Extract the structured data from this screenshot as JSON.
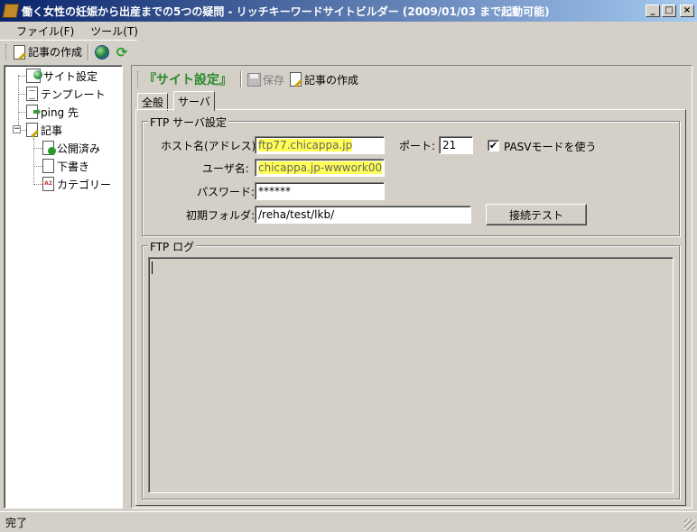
{
  "window": {
    "title": "働く女性の妊娠から出産までの5つの疑問 - リッチキーワードサイトビルダー (2009/01/03 まで起動可能)",
    "minimize": "_",
    "maximize": "□",
    "close": "×"
  },
  "menu": {
    "items": [
      "ファイル(F)",
      "ツール(T)"
    ]
  },
  "toolbar": {
    "create_article": "記事の作成"
  },
  "tree": {
    "site_settings": "サイト設定",
    "template": "テンプレート",
    "ping": "ping 先",
    "articles": "記事",
    "published": "公開済み",
    "draft": "下書き",
    "category": "カテゴリー",
    "category_icon_text": "A2"
  },
  "panel": {
    "title": "『サイト設定』",
    "save": "保存",
    "create_article": "記事の作成",
    "tabs": [
      "全般",
      "サーバ"
    ],
    "ftp_group": "FTP サーバ設定",
    "host_label": "ホスト名(アドレス):",
    "host_value": "ftp77.chicappa.jp",
    "port_label": "ポート:",
    "port_value": "21",
    "pasv_label": "PASVモードを使う",
    "pasv_checked": "✔",
    "user_label": "ユーザ名:",
    "user_value": "chicappa.jp-wwwork00",
    "password_label": "パスワード:",
    "password_value": "******",
    "folder_label": "初期フォルダ:",
    "folder_value": "/reha/test/lkb/",
    "connect_test": "接続テスト",
    "log_group": "FTP ログ"
  },
  "status": {
    "text": "完了"
  }
}
